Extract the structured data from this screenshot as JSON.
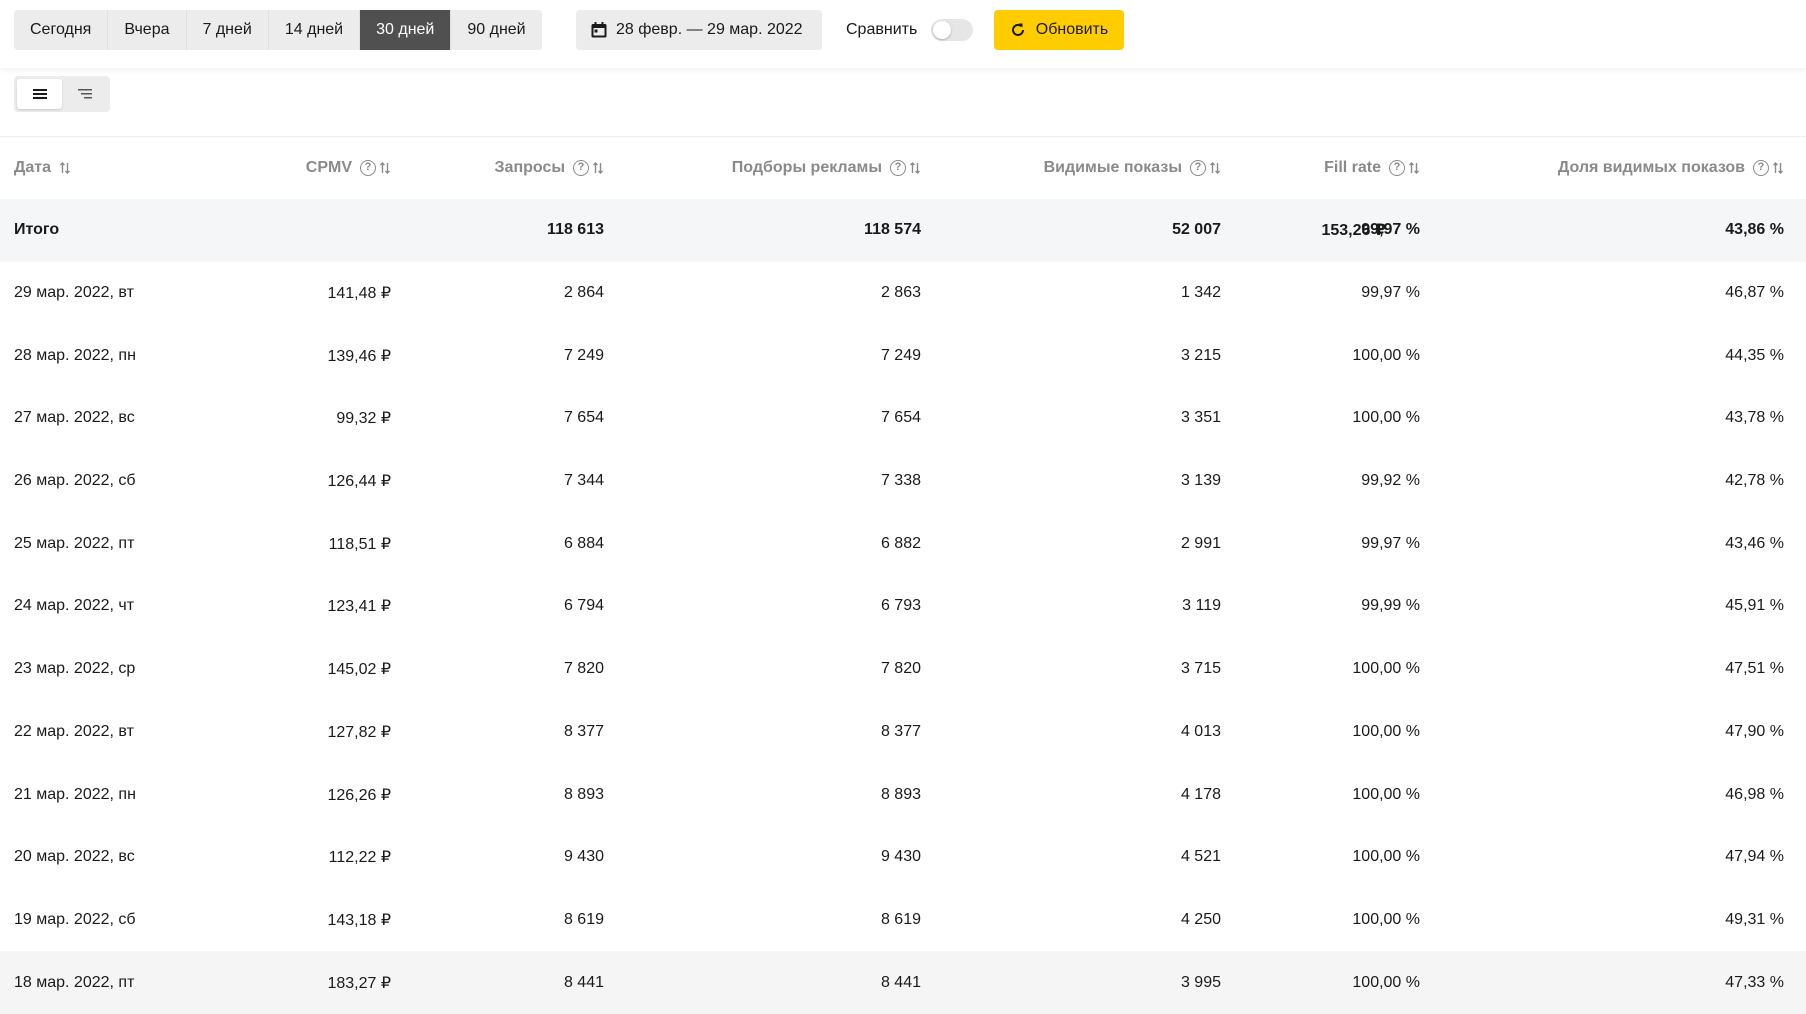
{
  "period_buttons": [
    {
      "label": "Сегодня",
      "active": false
    },
    {
      "label": "Вчера",
      "active": false
    },
    {
      "label": "7 дней",
      "active": false
    },
    {
      "label": "14 дней",
      "active": false
    },
    {
      "label": "30 дней",
      "active": true
    },
    {
      "label": "90 дней",
      "active": false
    }
  ],
  "date_range": "28 февр. — 29 мар. 2022",
  "compare_label": "Сравнить",
  "compare_enabled": false,
  "refresh_label": "Обновить",
  "colors": {
    "accent": "#ffcc00",
    "active_tab": "#505050"
  },
  "table": {
    "headers": [
      "Дата",
      "CPMV",
      "Запросы",
      "Подборы рекламы",
      "Видимые показы",
      "Fill rate",
      "Доля видимых показов"
    ],
    "total": [
      "Итого",
      "153,26 ₽",
      "118 613",
      "118 574",
      "52 007",
      "99,97 %",
      "43,86 %"
    ],
    "rows": [
      [
        "29 мар. 2022, вт",
        "141,48 ₽",
        "2 864",
        "2 863",
        "1 342",
        "99,97 %",
        "46,87 %"
      ],
      [
        "28 мар. 2022, пн",
        "139,46 ₽",
        "7 249",
        "7 249",
        "3 215",
        "100,00 %",
        "44,35 %"
      ],
      [
        "27 мар. 2022, вс",
        "99,32 ₽",
        "7 654",
        "7 654",
        "3 351",
        "100,00 %",
        "43,78 %"
      ],
      [
        "26 мар. 2022, сб",
        "126,44 ₽",
        "7 344",
        "7 338",
        "3 139",
        "99,92 %",
        "42,78 %"
      ],
      [
        "25 мар. 2022, пт",
        "118,51 ₽",
        "6 884",
        "6 882",
        "2 991",
        "99,97 %",
        "43,46 %"
      ],
      [
        "24 мар. 2022, чт",
        "123,41 ₽",
        "6 794",
        "6 793",
        "3 119",
        "99,99 %",
        "45,91 %"
      ],
      [
        "23 мар. 2022, ср",
        "145,02 ₽",
        "7 820",
        "7 820",
        "3 715",
        "100,00 %",
        "47,51 %"
      ],
      [
        "22 мар. 2022, вт",
        "127,82 ₽",
        "8 377",
        "8 377",
        "4 013",
        "100,00 %",
        "47,90 %"
      ],
      [
        "21 мар. 2022, пн",
        "126,26 ₽",
        "8 893",
        "8 893",
        "4 178",
        "100,00 %",
        "46,98 %"
      ],
      [
        "20 мар. 2022, вс",
        "112,22 ₽",
        "9 430",
        "9 430",
        "4 521",
        "100,00 %",
        "47,94 %"
      ],
      [
        "19 мар. 2022, сб",
        "143,18 ₽",
        "8 619",
        "8 619",
        "4 250",
        "100,00 %",
        "49,31 %"
      ],
      [
        "18 мар. 2022, пт",
        "183,27 ₽",
        "8 441",
        "8 441",
        "3 995",
        "100,00 %",
        "47,33 %"
      ]
    ]
  }
}
